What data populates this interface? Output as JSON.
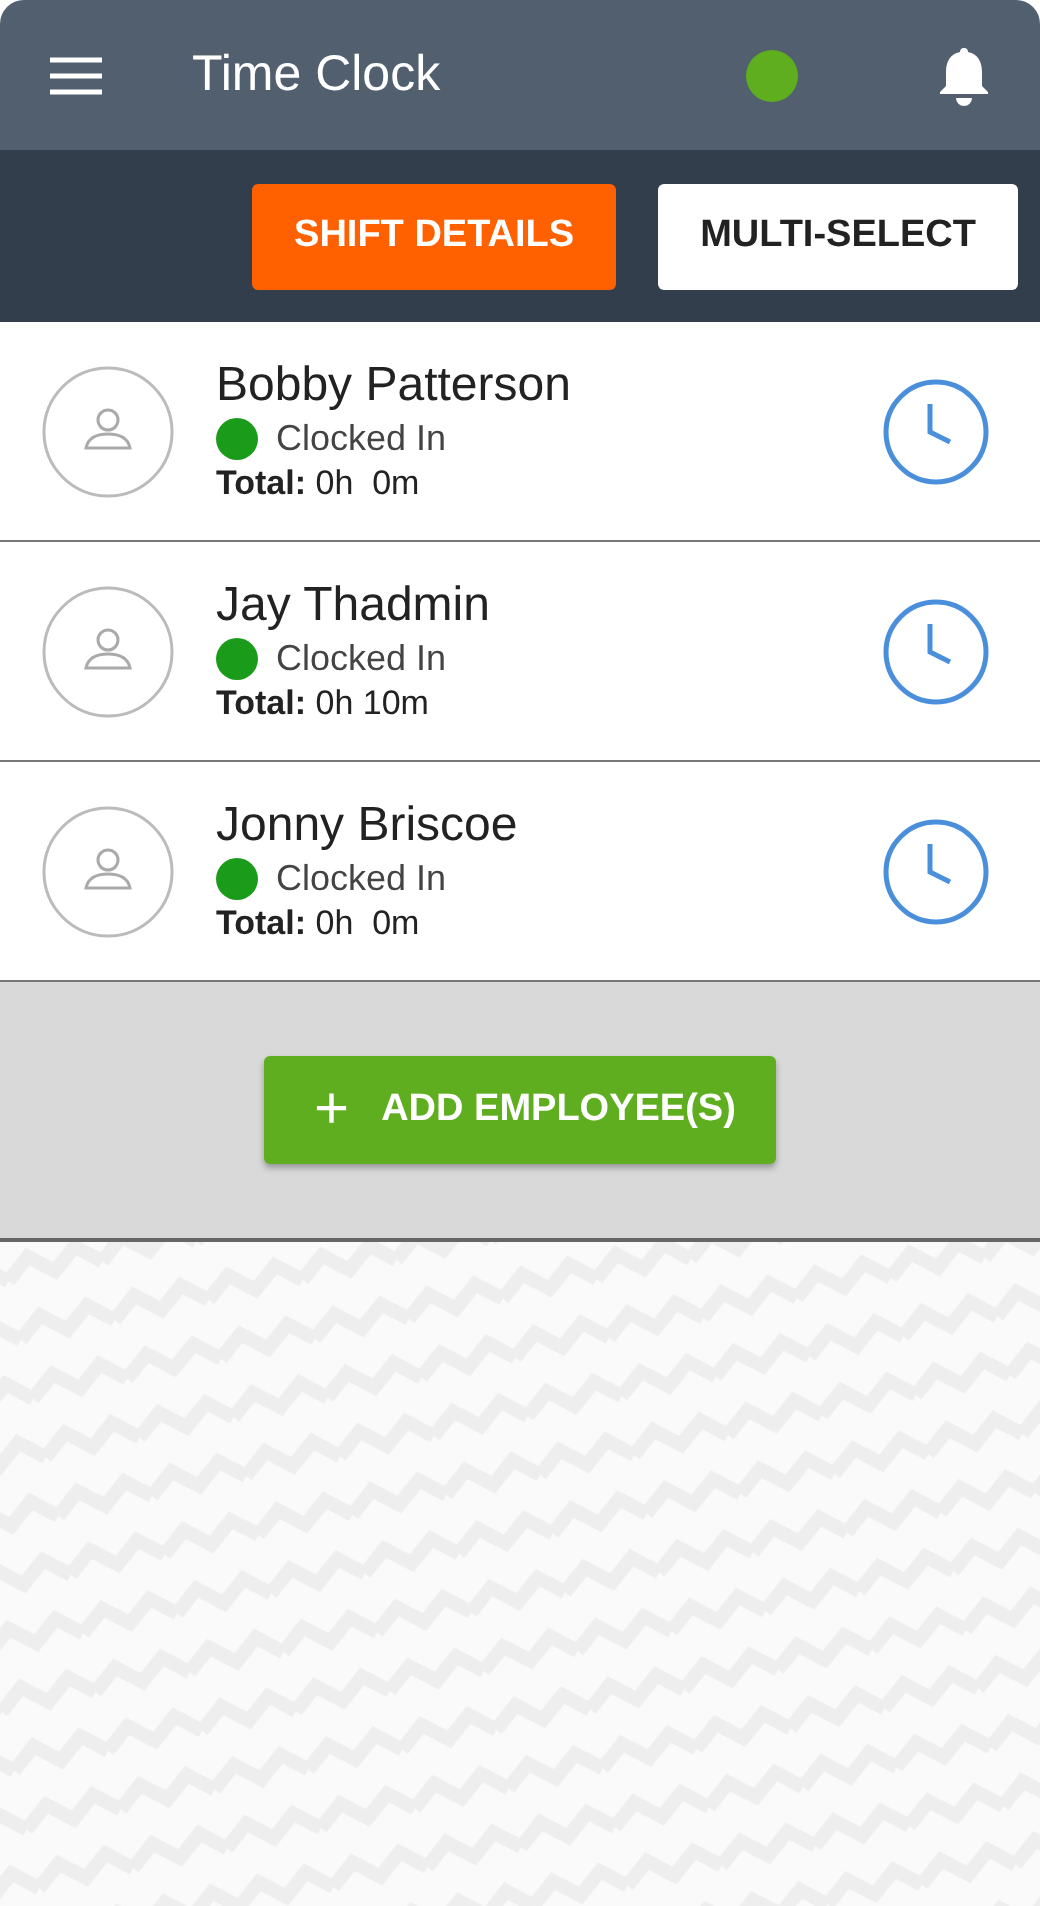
{
  "header": {
    "title": "Time Clock",
    "status_dot": {
      "color": "#5fae1f"
    }
  },
  "toolbar": {
    "buttons": [
      {
        "label": "SHIFT DETAILS",
        "kind": "primary"
      },
      {
        "label": "MULTI-SELECT",
        "kind": "secondary"
      }
    ]
  },
  "employees": [
    {
      "name": "Bobby Patterson",
      "status": "Clocked In",
      "color": "#1a9c1a",
      "total": "**Total:** 0h  0m"
    },
    {
      "name": "Jay Thadmin",
      "status": "Clocked In",
      "color": "#1a9c1a",
      "total": "**Total:** 0h 10m"
    },
    {
      "name": "Jonny Briscoe",
      "status": "Clocked In",
      "color": "#1a9c1a",
      "total": "**Total:** 0h  0m"
    }
  ],
  "add_button": {
    "icon": "+",
    "label": "ADD EMPLOYEE(S)"
  }
}
